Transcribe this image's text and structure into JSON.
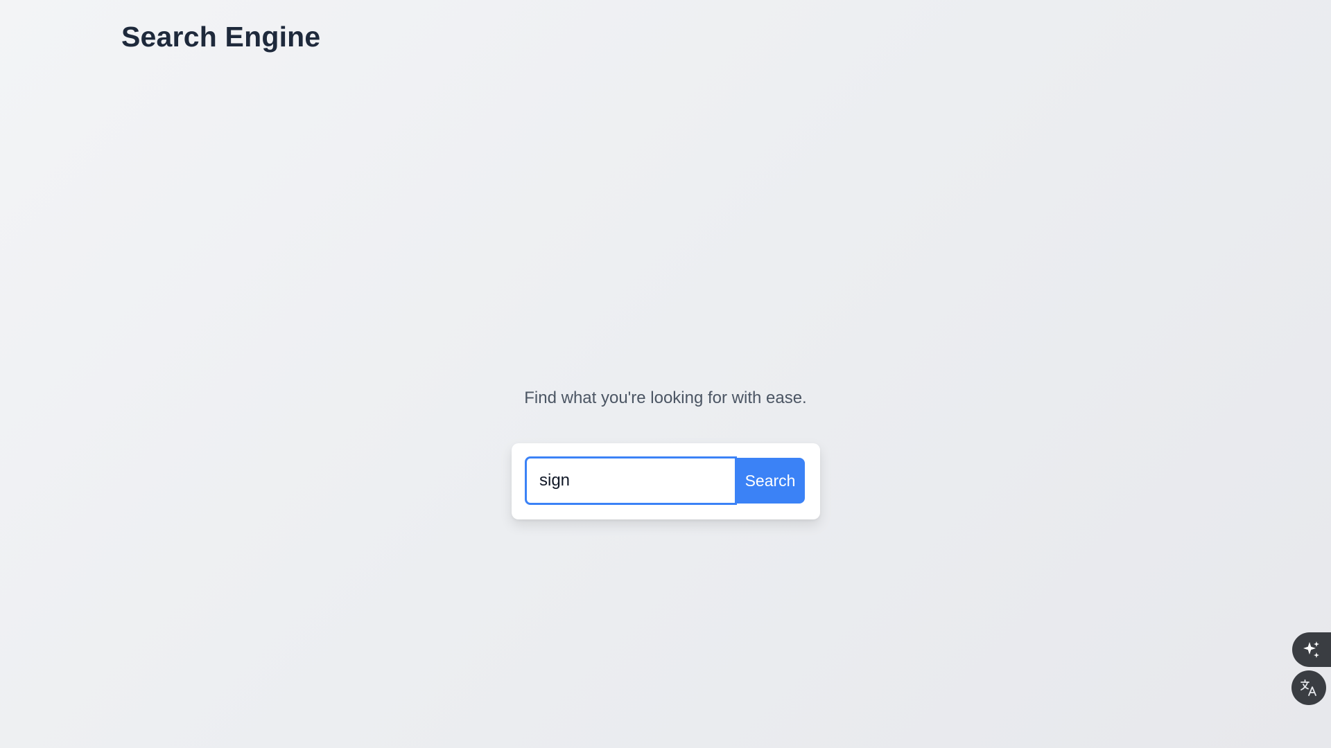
{
  "header": {
    "title": "Search Engine"
  },
  "main": {
    "tagline": "Find what you're looking for with ease.",
    "search": {
      "value": "sign",
      "placeholder": "",
      "button_label": "Search"
    }
  },
  "floating_actions": [
    {
      "icon": "sparkle-icon"
    },
    {
      "icon": "translate-icon"
    }
  ],
  "colors": {
    "accent": "#3b82f6",
    "title": "#1e293b",
    "tagline": "#4b5563",
    "floating_button": "#3a3d42"
  }
}
